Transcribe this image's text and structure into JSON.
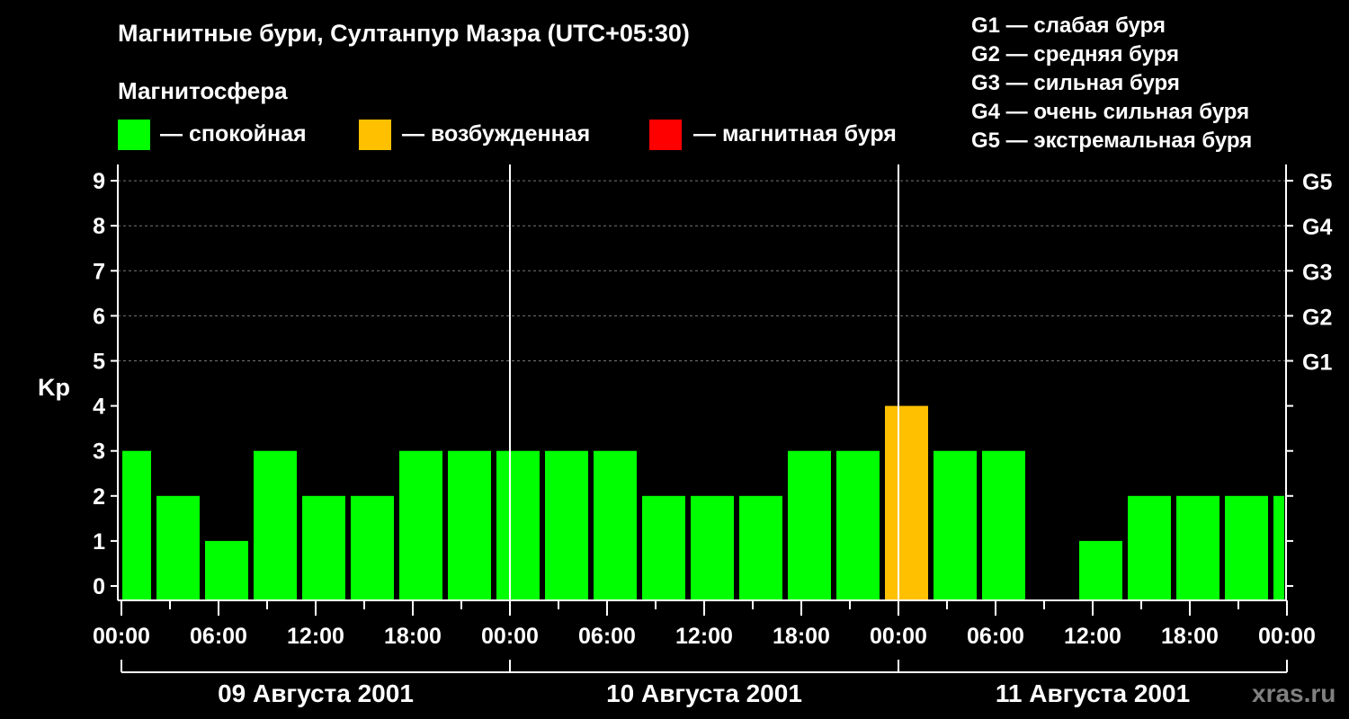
{
  "header": {
    "title": "Магнитные бури, Султанпур Мазра (UTC+05:30)",
    "subtitle": "Магнитосфера",
    "legend": [
      {
        "label": "— спокойная",
        "color": "#00ff00"
      },
      {
        "label": "— возбужденная",
        "color": "#ffc000"
      },
      {
        "label": "— магнитная буря",
        "color": "#ff0000"
      }
    ],
    "g_scale": [
      "G1 — слабая буря",
      "G2 — средняя буря",
      "G3 — сильная буря",
      "G4 — очень сильная буря",
      "G5 — экстремальная буря"
    ]
  },
  "watermark": "xras.ru",
  "chart_data": {
    "type": "bar",
    "ylabel": "Kp",
    "ylim": [
      0,
      9
    ],
    "yticks": [
      "0",
      "1",
      "2",
      "3",
      "4",
      "5",
      "6",
      "7",
      "8",
      "9"
    ],
    "right_ticks": [
      {
        "kp": 5,
        "label": "G1"
      },
      {
        "kp": 6,
        "label": "G2"
      },
      {
        "kp": 7,
        "label": "G3"
      },
      {
        "kp": 8,
        "label": "G4"
      },
      {
        "kp": 9,
        "label": "G5"
      }
    ],
    "x_range_hours": [
      0,
      72
    ],
    "xtick_labels": [
      "00:00",
      "06:00",
      "12:00",
      "18:00",
      "00:00",
      "06:00",
      "12:00",
      "18:00",
      "00:00",
      "06:00",
      "12:00",
      "18:00",
      "00:00"
    ],
    "days": [
      "09 Августа 2001",
      "10 Августа 2001",
      "11 Августа 2001"
    ],
    "bar_start_hours": [
      -1,
      2,
      5,
      8,
      11,
      14,
      17,
      20,
      23,
      26,
      29,
      32,
      35,
      38,
      41,
      44,
      47,
      50,
      53,
      56,
      59,
      62,
      65,
      68,
      71
    ],
    "values": [
      3,
      2,
      1,
      3,
      2,
      2,
      3,
      3,
      3,
      3,
      3,
      2,
      2,
      2,
      3,
      3,
      4,
      3,
      3,
      null,
      1,
      2,
      2,
      2,
      2
    ],
    "colors": {
      "quiet": "#00ff00",
      "active": "#ffc000",
      "storm": "#ff0000"
    }
  }
}
